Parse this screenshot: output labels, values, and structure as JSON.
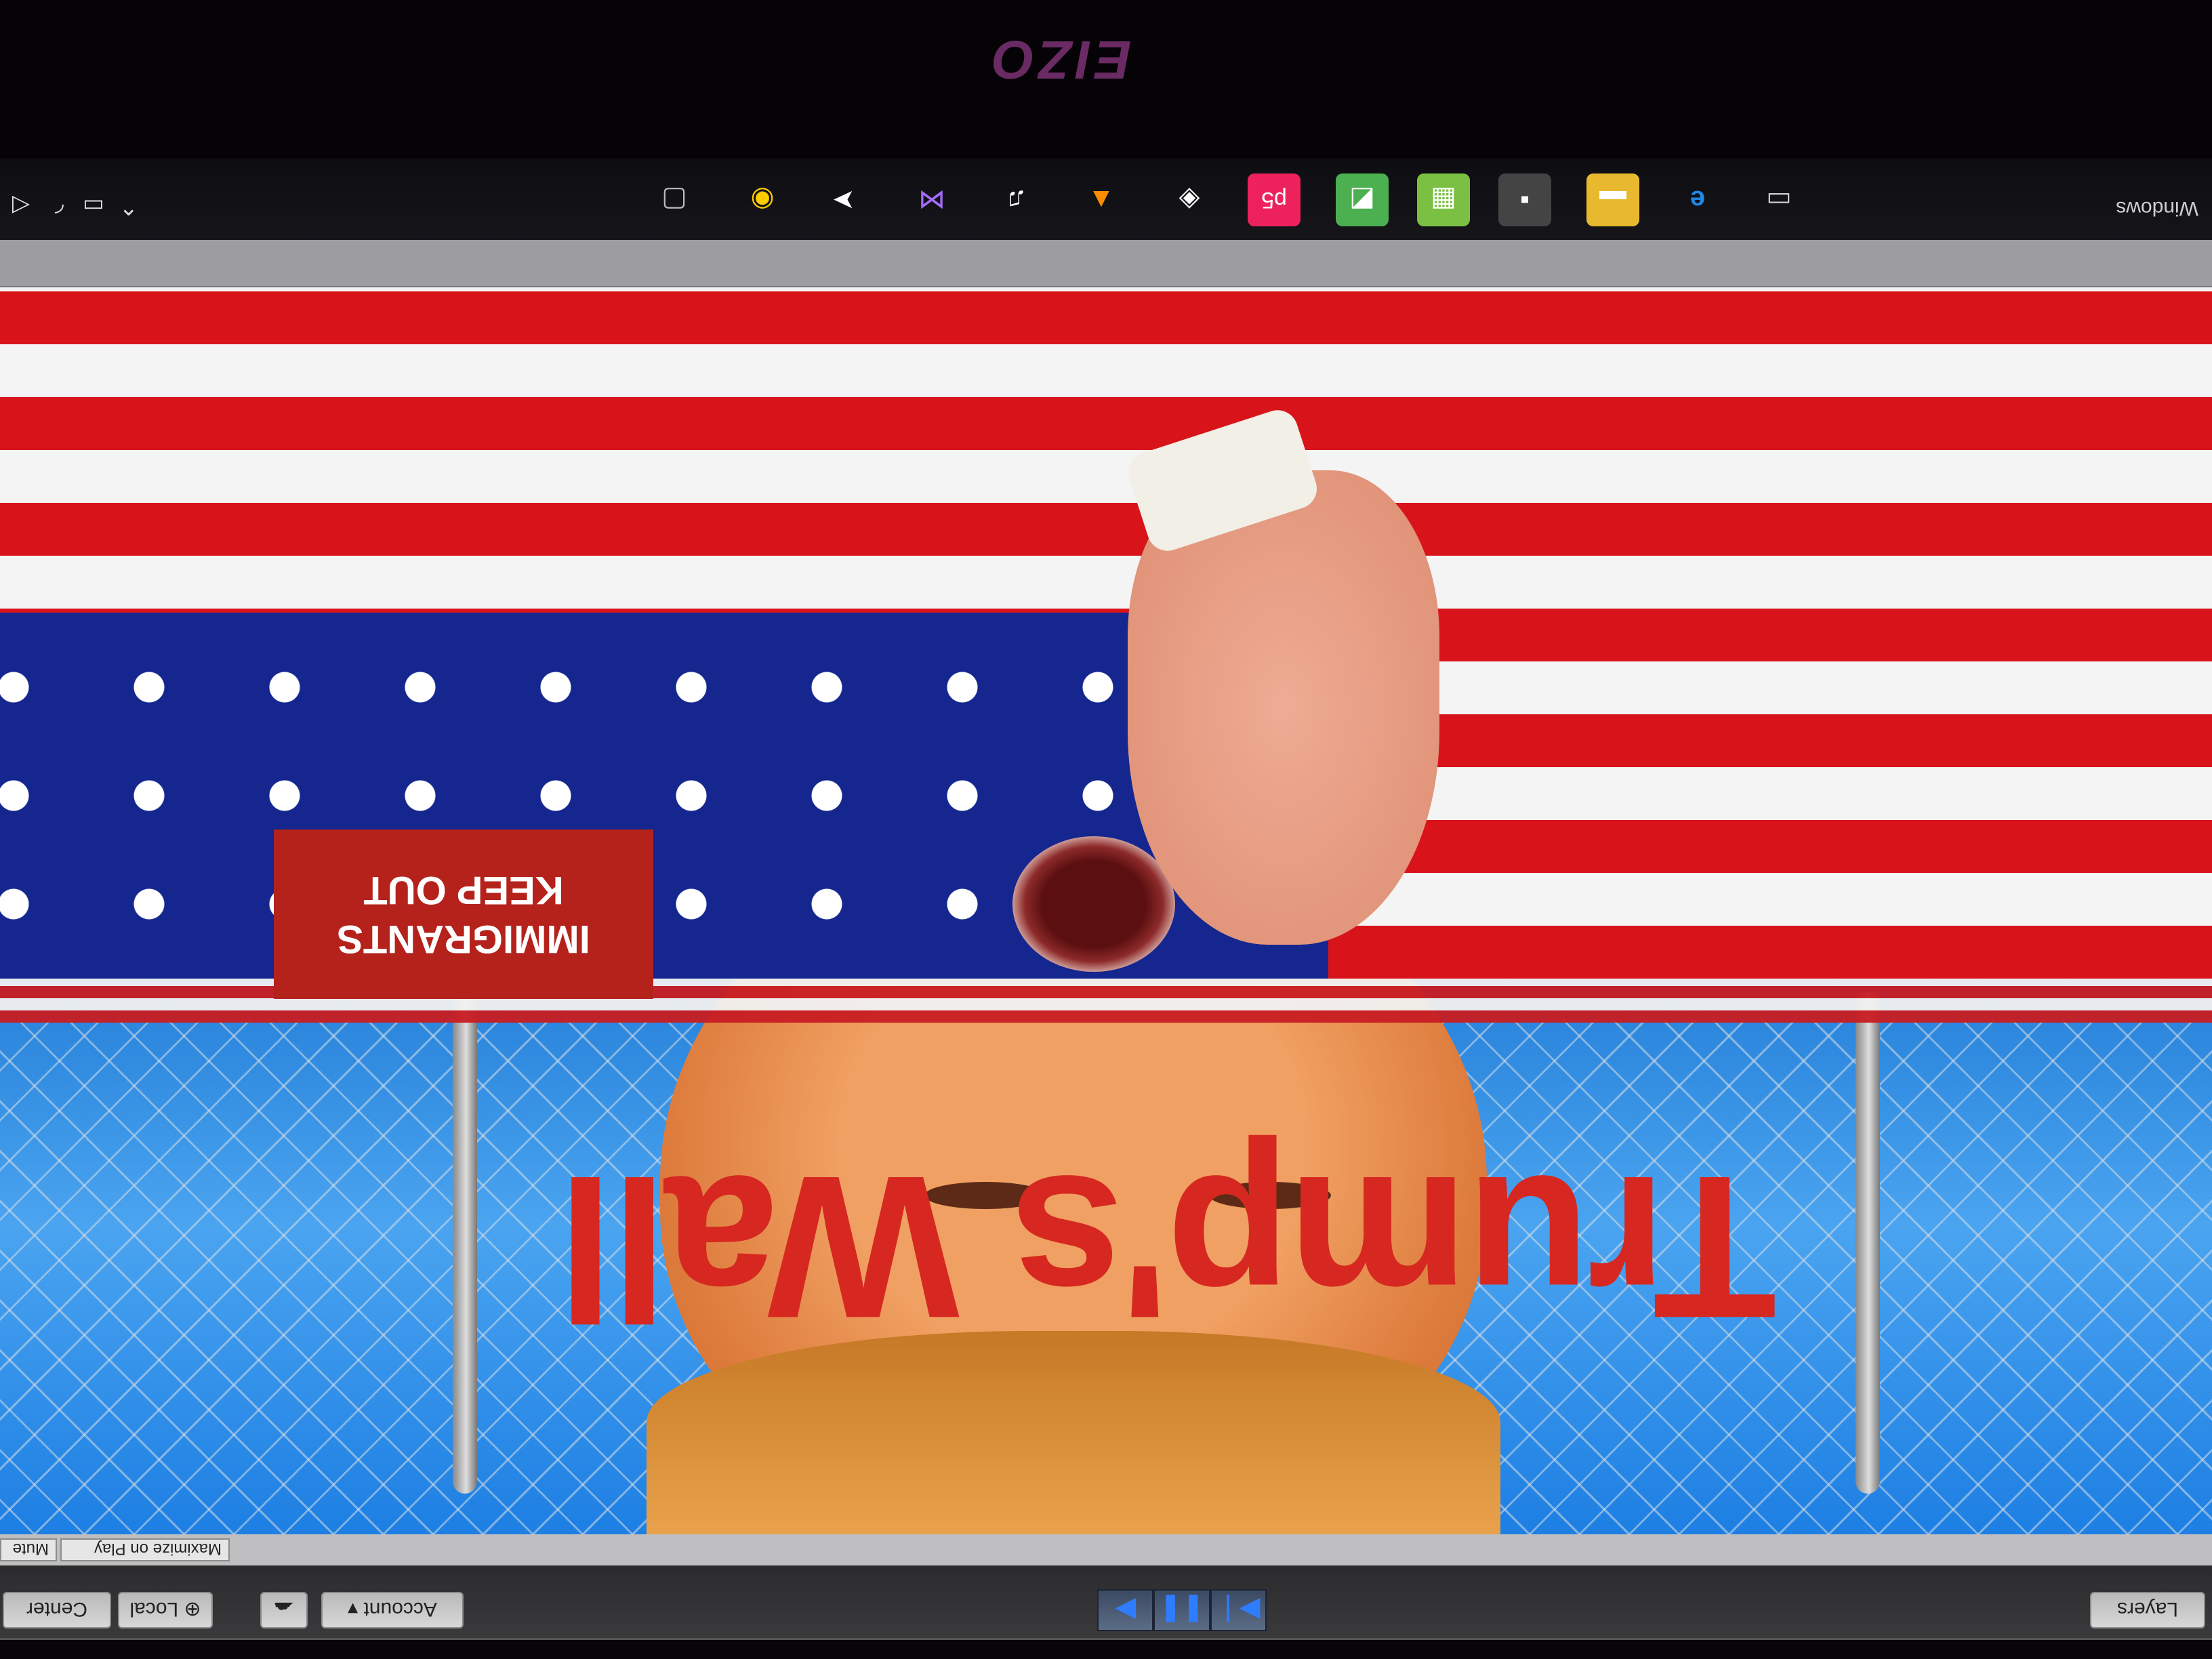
{
  "unity_toolbar": {
    "layers_label": "Layers",
    "account_label": "Account",
    "pivot_label": "Center",
    "space_label": "Local",
    "play_controls": [
      "▶",
      "❚❚",
      "▶❘"
    ]
  },
  "game_view_options": {
    "maximize_label": "Maximize on Play",
    "mute_label": "Mute"
  },
  "game": {
    "title": "Trump's Wall",
    "sign_line1": "IMMIGRANTS",
    "sign_line2": "KEEP OUT"
  },
  "taskbar": {
    "windows_label": "Windows",
    "icons": [
      "task-view",
      "edge",
      "file-explorer",
      "store",
      "cells",
      "minecraft",
      "p5",
      "unity",
      "vlc",
      "itunes",
      "visual-studio",
      "arrow-app",
      "chrome",
      "desktop"
    ]
  },
  "monitor": {
    "brand": "EIZO"
  },
  "colors": {
    "title_red": "#d62820",
    "sign_red": "#b5221c",
    "flag_blue": "#15268f",
    "taskbar": "#15151a"
  }
}
